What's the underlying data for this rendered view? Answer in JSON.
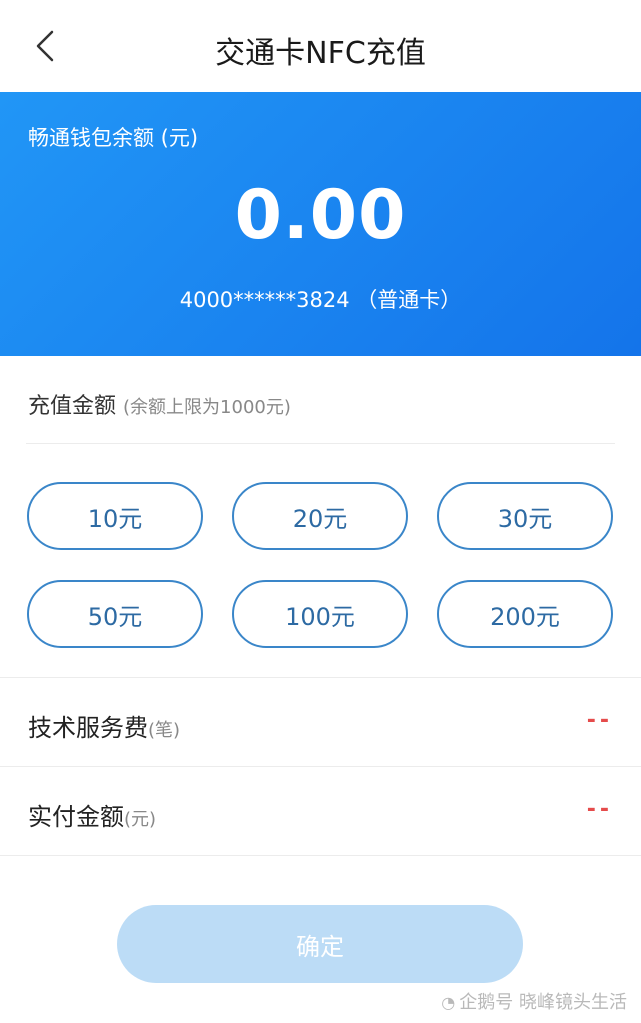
{
  "header": {
    "title": "交通卡NFC充值"
  },
  "wallet": {
    "label": "畅通钱包余额 (元)",
    "balance": "0.00",
    "card_info": "4000******3824 （普通卡）"
  },
  "recharge": {
    "title": "充值金额",
    "hint": "(余额上限为1000元)",
    "options": [
      "10元",
      "20元",
      "30元",
      "50元",
      "100元",
      "200元"
    ]
  },
  "fees": {
    "service_fee_label": "技术服务费",
    "service_fee_unit": "(笔)",
    "service_fee_value": "--",
    "paid_label": "实付金额",
    "paid_unit": "(元)",
    "paid_value": "--"
  },
  "confirm_label": "确定",
  "watermark": {
    "icon": "penguin-icon",
    "text": "企鹅号 晓峰镜头生活"
  },
  "colors": {
    "banner": "#1a86f0",
    "chip_border": "#3a86c9",
    "dash": "#e54b4b",
    "confirm_disabled": "#bcdcf6"
  }
}
